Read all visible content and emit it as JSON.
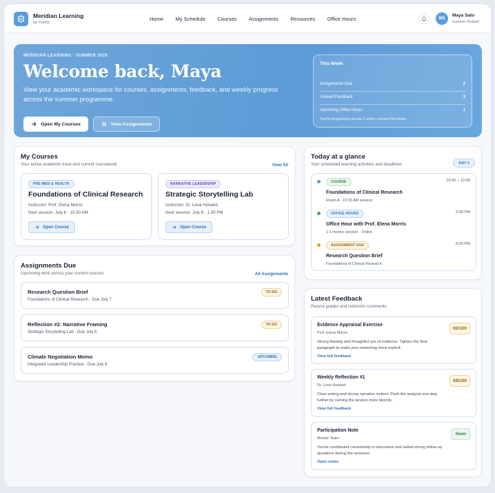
{
  "brand": {
    "title": "Meridian Learning",
    "subtitle": "by Yuvela"
  },
  "nav": {
    "items": [
      "Home",
      "My Schedule",
      "Courses",
      "Assignments",
      "Resources",
      "Office Hours"
    ]
  },
  "user": {
    "initials": "MS",
    "name": "Maya Sato",
    "role": "Summer Student"
  },
  "hero": {
    "eyebrow": "MERIDIAN LEARNING · SUMMER 2026",
    "title": "Welcome back, Maya",
    "description": "View your academic workspace for courses, assignments, feedback, and weekly progress across the summer programme.",
    "primary_button": "Open My Courses",
    "secondary_button": "View Assignments",
    "week": {
      "title": "This Week",
      "rows": [
        {
          "label": "Assignments Due",
          "value": "2"
        },
        {
          "label": "Unread Feedback",
          "value": "3"
        },
        {
          "label": "Upcoming Office Hours",
          "value": "1"
        }
      ],
      "note": "You're progressing across 2 active courses this week."
    }
  },
  "courses": {
    "title": "My Courses",
    "subtitle": "Your active academic track and current coursework",
    "link": "View All",
    "items": [
      {
        "tag": "PRE-MED & HEALTH",
        "name": "Foundations of Clinical Research",
        "instructor": "Instructor: Prof. Elena Morris",
        "next": "Next session: July 6 · 10:30 AM",
        "button": "Open Course"
      },
      {
        "tag": "NARRATIVE LEADERSHIP",
        "name": "Strategic Storytelling Lab",
        "instructor": "Instructor: Dr. Lena Howard",
        "next": "Next session: July 6 · 1:30 PM",
        "button": "Open Course"
      }
    ]
  },
  "assignments": {
    "title": "Assignments Due",
    "subtitle": "Upcoming work across your current courses",
    "link": "All Assignments",
    "items": [
      {
        "name": "Research Question Brief",
        "meta": "Foundations of Clinical Research · Due July 7",
        "status": "TO DO"
      },
      {
        "name": "Reflection #2: Narrative Framing",
        "meta": "Strategic Storytelling Lab · Due July 8",
        "status": "TO DO"
      },
      {
        "name": "Climate Negotiation Memo",
        "meta": "Integrated Leadership Practice · Due July 9",
        "status": "UPCOMING"
      }
    ]
  },
  "today": {
    "title": "Today at a glance",
    "subtitle": "Your scheduled learning activities and deadlines",
    "badge": "DAY 3",
    "colors": {
      "course": "#5a9ddb",
      "office": "#3fa66a",
      "due": "#d9a52c"
    },
    "items": [
      {
        "tag": "COURSE",
        "title": "Foundations of Clinical Research",
        "meta": "Room A · 10:30 AM session",
        "time": "10:30 – 12:00"
      },
      {
        "tag": "OFFICE HOURS",
        "title": "Office Hour with Prof. Elena Morris",
        "meta": "1:1 mentor session · Online",
        "time": "2:30 PM"
      },
      {
        "tag": "ASSIGNMENT DUE",
        "title": "Research Question Brief",
        "meta": "Foundations of Clinical Research",
        "time": "6:00 PM"
      }
    ]
  },
  "feedback": {
    "title": "Latest Feedback",
    "subtitle": "Recent grades and instructor comments",
    "items": [
      {
        "title": "Evidence Appraisal Exercise",
        "author": "Prof. Elena Morris",
        "text": "Strong framing and thoughtful use of evidence. Tighten the final paragraph to make your reasoning more explicit.",
        "link": "View full feedback",
        "grade": "92/100"
      },
      {
        "title": "Weekly Reflection #1",
        "author": "Dr. Lena Howard",
        "text": "Clear writing and strong narrative instinct. Push the analysis one step further by naming the tension more directly.",
        "link": "View full feedback",
        "grade": "89/100"
      },
      {
        "title": "Participation Note",
        "author": "Mentor Team",
        "text": "You've contributed consistently in discussion and asked strong follow-up questions during live sessions.",
        "link": "Open notes",
        "grade": "Seen"
      }
    ]
  }
}
